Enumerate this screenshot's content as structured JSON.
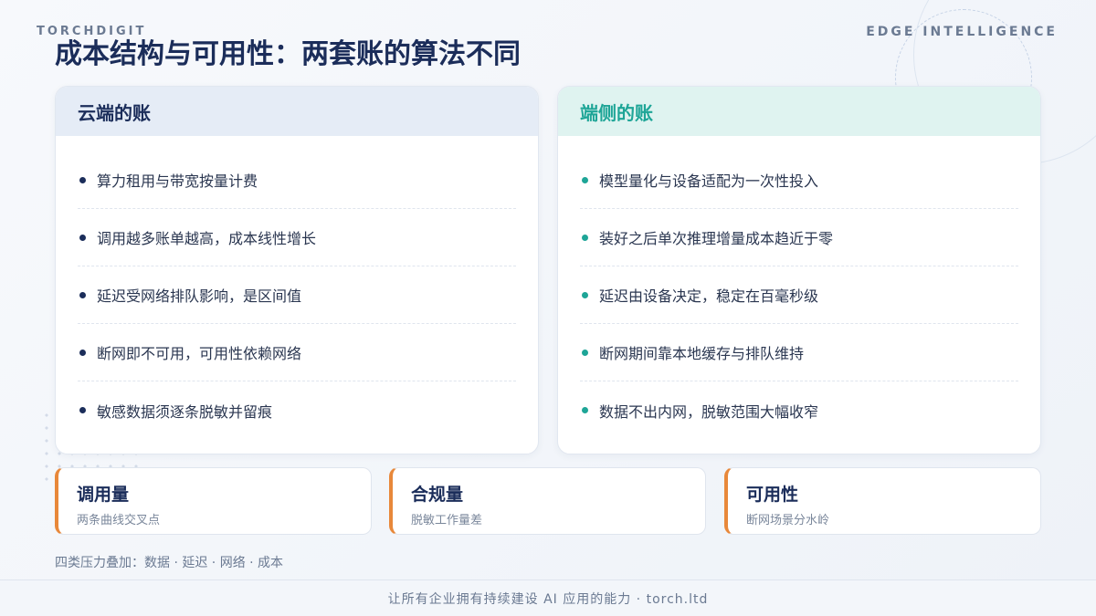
{
  "brand": {
    "left": "TORCHDIGIT",
    "right": "EDGE INTELLIGENCE"
  },
  "title": "成本结构与可用性：两套账的算法不同",
  "cloud": {
    "heading": "云端的账",
    "items": [
      "算力租用与带宽按量计费",
      "调用越多账单越高，成本线性增长",
      "延迟受网络排队影响，是区间值",
      "断网即不可用，可用性依赖网络",
      "敏感数据须逐条脱敏并留痕"
    ]
  },
  "edge": {
    "heading": "端侧的账",
    "items": [
      "模型量化与设备适配为一次性投入",
      "装好之后单次推理增量成本趋近于零",
      "延迟由设备决定，稳定在百毫秒级",
      "断网期间靠本地缓存与排队维持",
      "数据不出内网，脱敏范围大幅收窄"
    ]
  },
  "metrics": [
    {
      "title": "调用量",
      "sub": "两条曲线交叉点"
    },
    {
      "title": "合规量",
      "sub": "脱敏工作量差"
    },
    {
      "title": "可用性",
      "sub": "断网场景分水岭"
    }
  ],
  "footnote": "四类压力叠加：数据 · 延迟 · 网络 · 成本",
  "footer": "让所有企业拥有持续建设 AI 应用的能力  ·  torch.ltd",
  "colors": {
    "navy": "#1b2d5a",
    "teal": "#1ea597",
    "orange": "#e8883a"
  }
}
